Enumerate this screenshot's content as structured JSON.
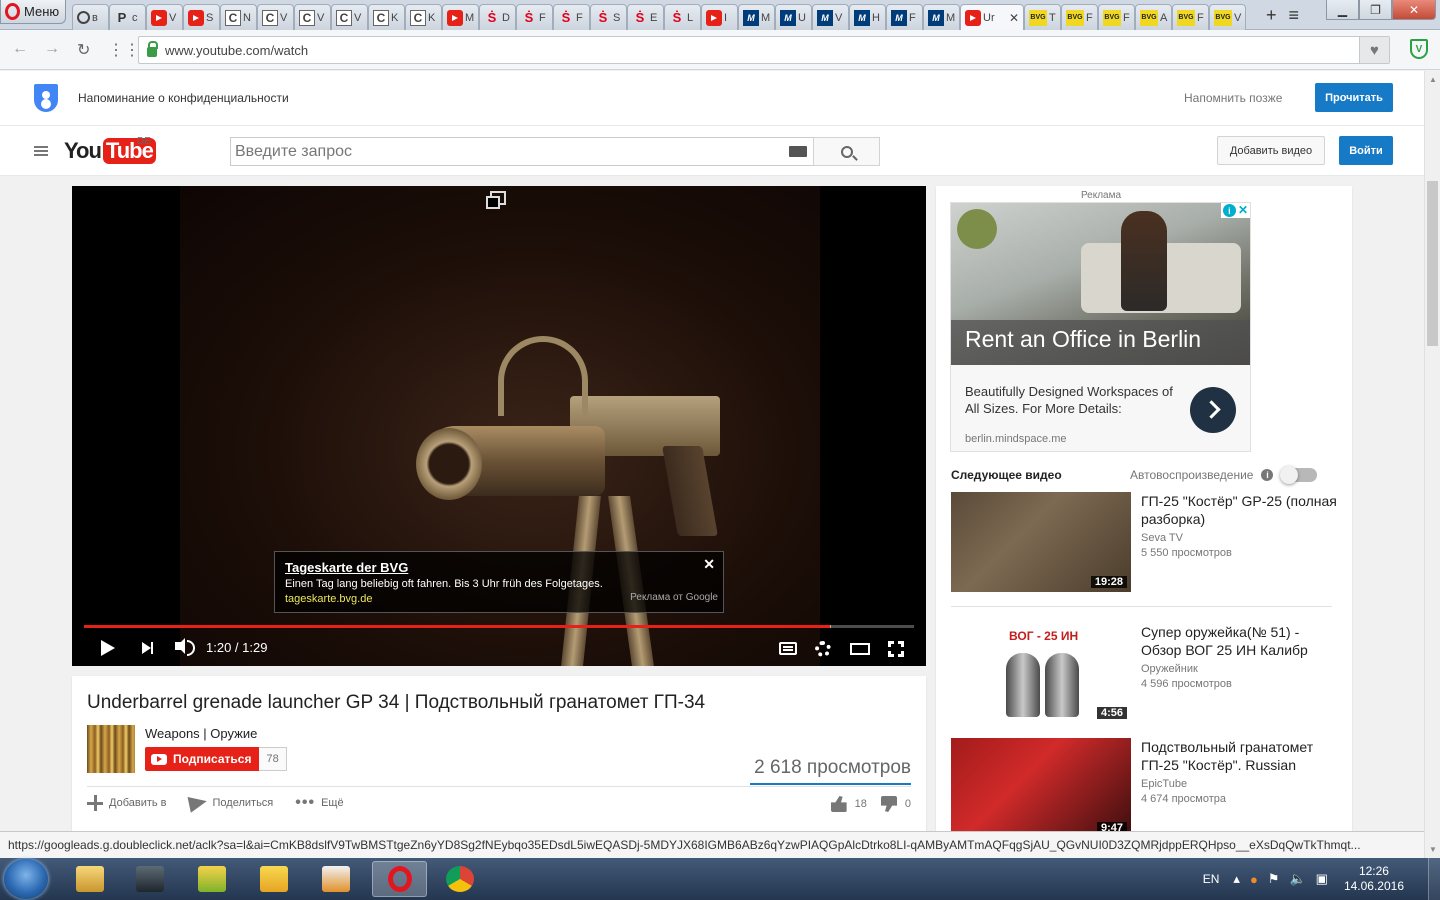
{
  "browser": {
    "menu_label": "Меню",
    "tabs": [
      {
        "icon": "clock-icon",
        "label": "в"
      },
      {
        "icon": "p-icon",
        "label": "c"
      },
      {
        "icon": "youtube-icon",
        "label": "V"
      },
      {
        "icon": "youtube-icon",
        "label": "S"
      },
      {
        "icon": "c-icon",
        "label": "N"
      },
      {
        "icon": "c-icon",
        "label": "V"
      },
      {
        "icon": "c-icon",
        "label": "V"
      },
      {
        "icon": "c-icon",
        "label": "V"
      },
      {
        "icon": "c-icon",
        "label": "K"
      },
      {
        "icon": "c-icon",
        "label": "K"
      },
      {
        "icon": "youtube-icon",
        "label": "M"
      },
      {
        "icon": "sparkasse-icon",
        "label": "D"
      },
      {
        "icon": "sparkasse-icon",
        "label": "F"
      },
      {
        "icon": "sparkasse-icon",
        "label": "F"
      },
      {
        "icon": "sparkasse-icon",
        "label": "S"
      },
      {
        "icon": "sparkasse-icon",
        "label": "E"
      },
      {
        "icon": "sparkasse-icon",
        "label": "L"
      },
      {
        "icon": "youtube-icon",
        "label": "I"
      },
      {
        "icon": "m-icon",
        "label": "M"
      },
      {
        "icon": "m-icon",
        "label": "U"
      },
      {
        "icon": "m-icon",
        "label": "V"
      },
      {
        "icon": "m-icon",
        "label": "H"
      },
      {
        "icon": "m-icon",
        "label": "F"
      },
      {
        "icon": "m-icon",
        "label": "M"
      }
    ],
    "active_tab": {
      "icon": "youtube-icon",
      "label": "Ur"
    },
    "tabs_after": [
      {
        "icon": "bvg-icon",
        "label": "T"
      },
      {
        "icon": "bvg-icon",
        "label": "F"
      },
      {
        "icon": "bvg-icon",
        "label": "F"
      },
      {
        "icon": "bvg-icon",
        "label": "A"
      },
      {
        "icon": "bvg-icon",
        "label": "F"
      },
      {
        "icon": "bvg-icon",
        "label": "V"
      }
    ],
    "bvg_text": "BVG",
    "url": "www.youtube.com/watch",
    "status_url": "https://googleads.g.doubleclick.net/aclk?sa=l&ai=CmKB8dslfV9TwBMSTtgeZn6yYD8Sg2fNEybqo35EDsdL5iwEQASDj-5MDYJX68IGMB6ABz6qYzwPIAQGpAlcDtrko8LI-qAMByAMTmAQFqgSjAU_QGvNUI0D3ZQMRjdppERQHpso__eXsDqQwTkThmqt..."
  },
  "privacy": {
    "text": "Напоминание о конфиденциальности",
    "later": "Напомнить позже",
    "read": "Прочитать"
  },
  "masthead": {
    "logo_you": "You",
    "logo_tube": "Tube",
    "country": "DE",
    "search_placeholder": "Введите запрос",
    "upload": "Добавить видео",
    "signin": "Войти"
  },
  "player": {
    "time": "1:20 / 1:29",
    "progress_played": 0.899,
    "progress_loaded": 0.9,
    "ad_overlay": {
      "title": "Tageskarte der BVG",
      "desc": "Einen Tag lang beliebig oft fahren. Bis 3 Uhr früh des Folgetages.",
      "url": "tageskarte.bvg.de",
      "label": "Реклама от Google",
      "close": "✕"
    }
  },
  "video": {
    "title": "Underbarrel grenade launcher GP 34 | Подствольный гранатомет ГП-34",
    "channel": "Weapons | Оружие",
    "subscribe": "Подписаться",
    "subscribers": "78",
    "views": "2 618 просмотров",
    "add_to": "Добавить в",
    "share": "Поделиться",
    "more": "Ещё",
    "likes": "18",
    "dislikes": "0"
  },
  "sidebar": {
    "ad_label": "Реклама",
    "ad": {
      "headline": "Rent an Office in Berlin",
      "desc": "Beautifully Designed Workspaces of All Sizes. For More Details:",
      "url": "berlin.mindspace.me"
    },
    "up_next": "Следующее видео",
    "autoplay": "Автовоспроизведение",
    "autoplay_on": false,
    "recommendations": [
      {
        "title": "ГП-25 \"Костёр\" GP-25 (полная разборка)",
        "channel": "Seva TV",
        "views": "5 550 просмотров",
        "duration": "19:28"
      },
      {
        "title": "Супер оружейка(№ 51) - Обзор ВОГ 25 ИН Калибр",
        "channel": "Оружейник",
        "views": "4 596 просмотров",
        "duration": "4:56",
        "thumb_text": "ВОГ - 25 ИН"
      },
      {
        "title": "Подствольный гранатомет ГП-25 \"Костёр\". Russian",
        "channel": "EpicTube",
        "views": "4 674 просмотра",
        "duration": "9:47"
      }
    ]
  },
  "taskbar": {
    "lang": "EN",
    "time": "12:26",
    "date": "14.06.2016"
  }
}
